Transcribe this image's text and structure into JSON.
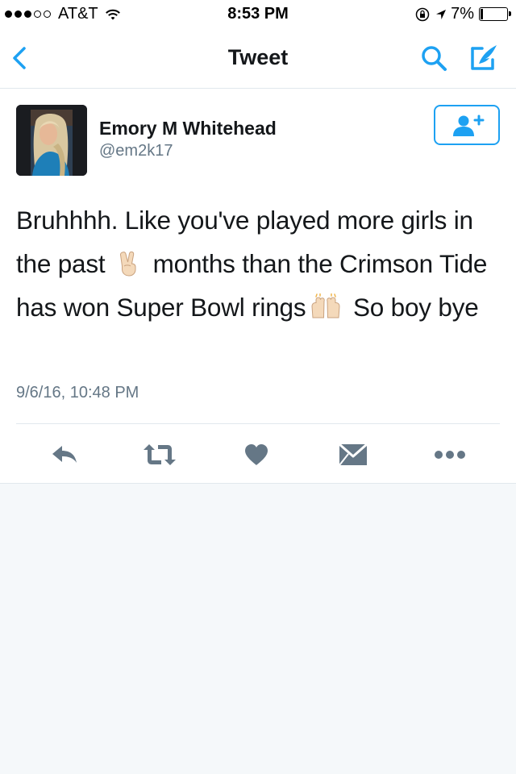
{
  "status_bar": {
    "carrier": "AT&T",
    "signal_bars_filled": 3,
    "signal_bars_total": 5,
    "time": "8:53 PM",
    "battery_percent": "7%"
  },
  "nav": {
    "title": "Tweet",
    "icons": {
      "back": "chevron-left-icon",
      "search": "search-icon",
      "compose": "compose-icon"
    }
  },
  "tweet": {
    "author": {
      "name": "Emory M Whitehead",
      "handle": "@em2k17"
    },
    "text": {
      "part1": "Bruhhhh. Like you've played more girls in the past",
      "part2": "months than the Crimson Tide has won Super Bowl rings",
      "part3": "So boy bye"
    },
    "emojis": [
      "victory-hand-emoji",
      "raised-hands-emoji"
    ],
    "timestamp": "9/6/16, 10:48 PM",
    "actions": [
      "reply-icon",
      "retweet-icon",
      "like-icon",
      "direct-message-icon",
      "more-icon"
    ]
  },
  "colors": {
    "accent": "#1da1f2",
    "icon_gray": "#657786",
    "background": "#f5f8fa"
  }
}
